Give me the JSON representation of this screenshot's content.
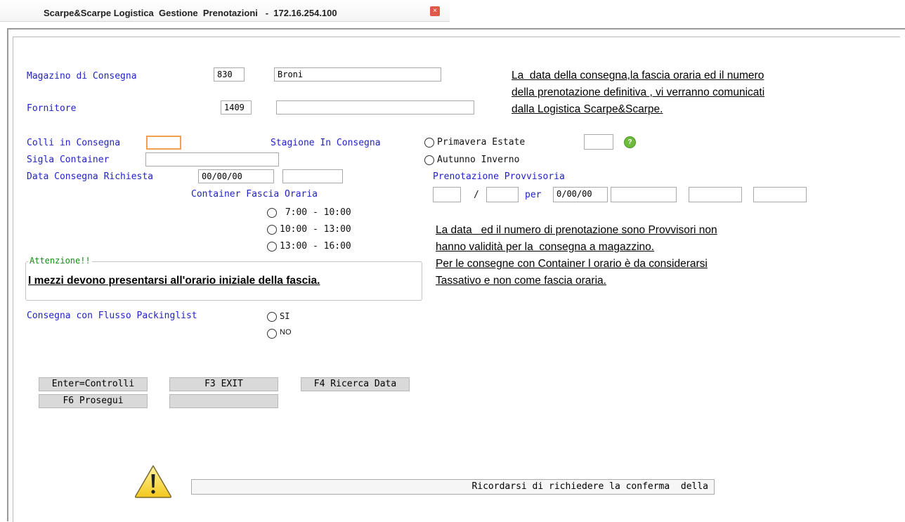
{
  "window": {
    "title": "Scarpe&Scarpe Logistica  Gestione  Prenotazioni   -  172.16.254.100",
    "close_icon": "close-icon"
  },
  "magazzino": {
    "label": "Magazino di Consegna",
    "code": "830",
    "name": "Broni"
  },
  "fornitore": {
    "label": "Fornitore",
    "code": "1409",
    "name": ""
  },
  "notice_top": [
    "La  data della consegna,la fascia oraria ed il numero",
    "della prenotazione definitiva , vi verranno comunicati",
    "dalla Logistica Scarpe&Scarpe."
  ],
  "colli": {
    "label": "Colli in Consegna",
    "value": ""
  },
  "stagione": {
    "label": "Stagione In Consegna",
    "options": [
      "Primavera Estate",
      "Autunno Inverno"
    ],
    "code": "",
    "help_icon": "help-icon"
  },
  "sigla_container": {
    "label": "Sigla Container",
    "value": ""
  },
  "data_consegna": {
    "label": "Data Consegna Richiesta",
    "value": "00/00/00",
    "extra": ""
  },
  "prenotazione": {
    "label": "Prenotazione Provvisoria",
    "field1": "",
    "separator": "/",
    "field2": "",
    "per_label": "per",
    "date": "0/00/00",
    "field3": "",
    "field4": "",
    "field5": ""
  },
  "container_fascia": {
    "label": "Container Fascia Oraria",
    "options": [
      " 7:00 - 10:00",
      "10:00 - 13:00",
      "13:00 - 16:00"
    ]
  },
  "notice_mid": [
    "La data   ed il numero di prenotazione sono Provvisori non",
    "hanno validità per la  consegna a magazzino.",
    "Per le consegne con Container l orario è da considerarsi",
    "Tassativo e non come fascia oraria."
  ],
  "attenzione": {
    "legend": "Attenzione!!",
    "text": "I mezzi devono presentarsi all'orario iniziale della fascia."
  },
  "packinglist": {
    "label": "Consegna con Flusso Packinglist",
    "options": [
      "SI",
      "NO"
    ]
  },
  "buttons": {
    "enter": "Enter=Controlli",
    "f3": "F3 EXIT",
    "f4": "F4 Ricerca Data",
    "f6": "F6 Prosegui",
    "blank": ""
  },
  "status": {
    "warning_icon": "warning-icon",
    "message": "Ricordarsi di richiedere la conferma  della"
  }
}
